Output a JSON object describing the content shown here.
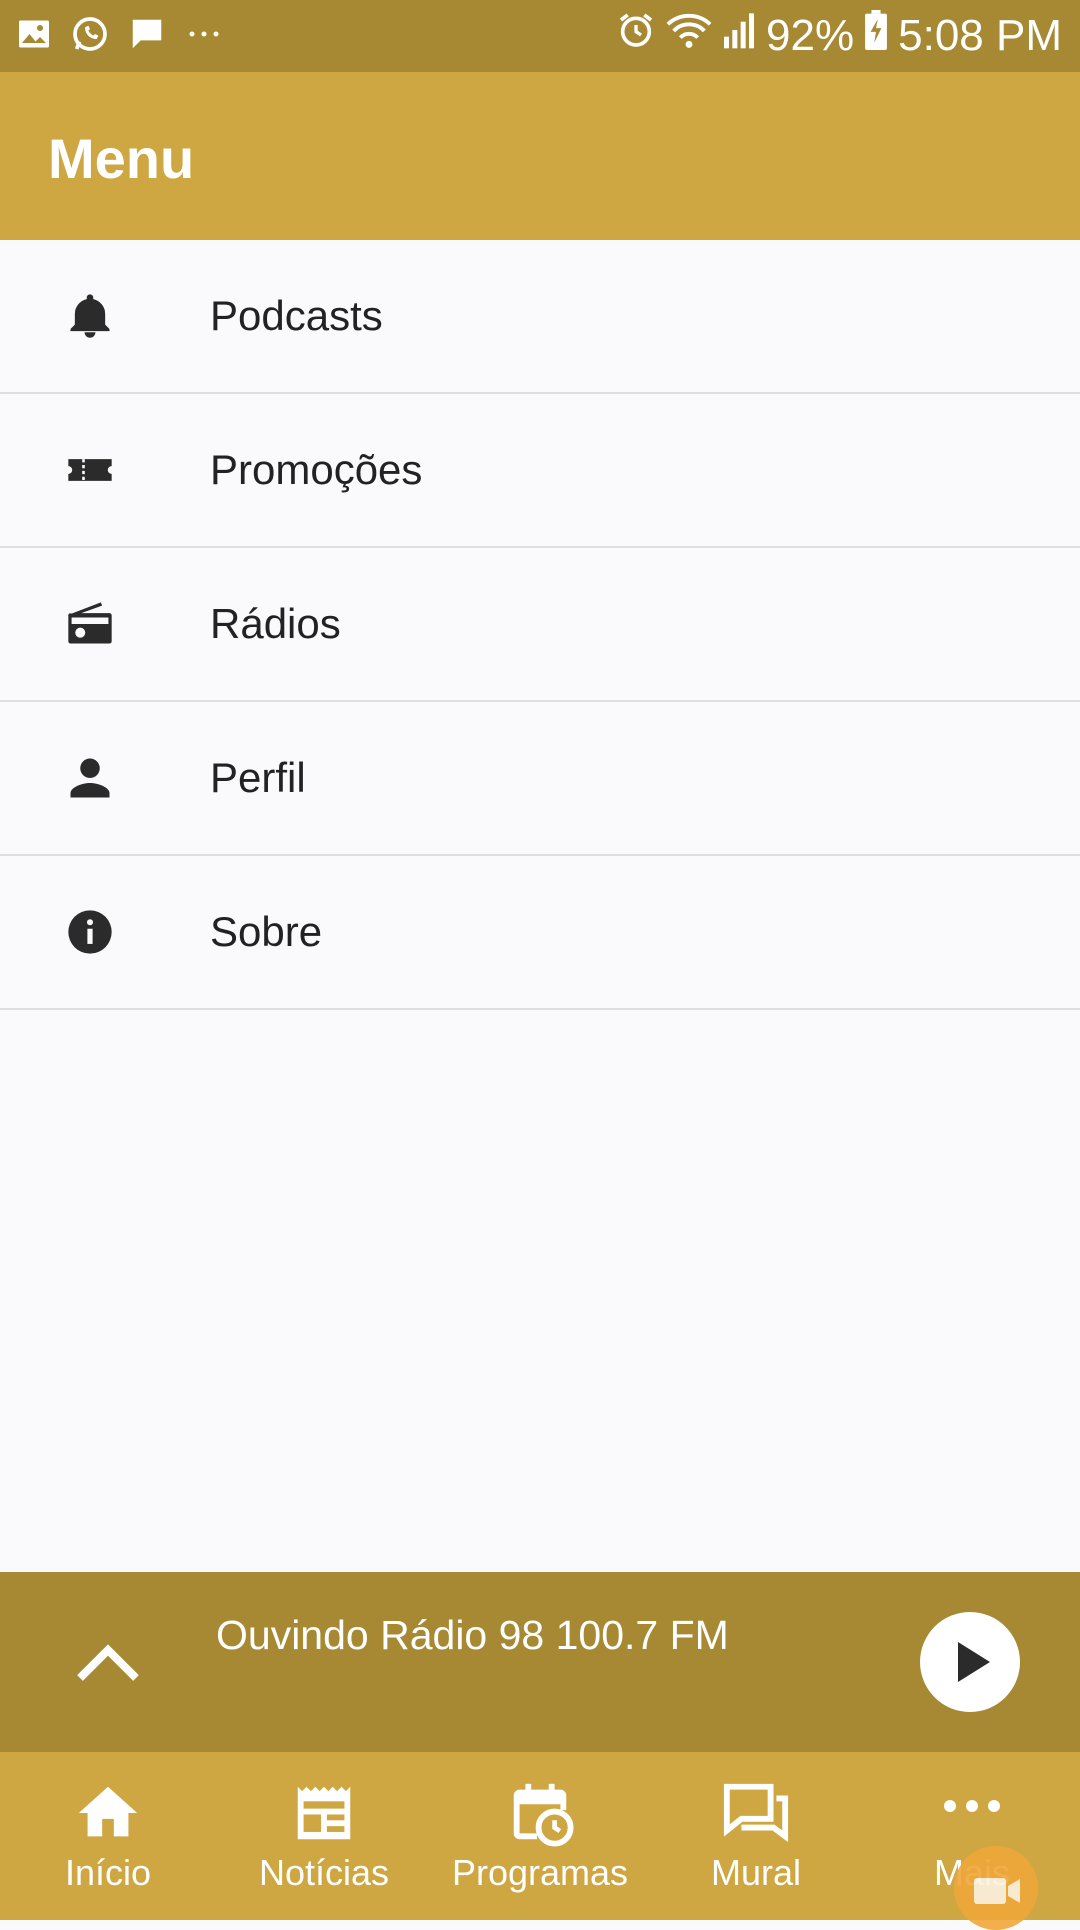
{
  "status_bar": {
    "battery": "92%",
    "time": "5:08 PM",
    "icons": [
      "gallery-icon",
      "whatsapp-icon",
      "message-icon",
      "more-dots-icon",
      "alarm-icon",
      "wifi-icon",
      "signal-icon",
      "battery-icon"
    ]
  },
  "app_bar": {
    "title": "Menu"
  },
  "menu": {
    "items": [
      {
        "label": "Podcasts",
        "icon": "bell-icon"
      },
      {
        "label": "Promoções",
        "icon": "ticket-icon"
      },
      {
        "label": "Rádios",
        "icon": "radio-icon"
      },
      {
        "label": "Perfil",
        "icon": "person-icon"
      },
      {
        "label": "Sobre",
        "icon": "info-icon"
      }
    ]
  },
  "player": {
    "now_playing": "Ouvindo Rádio 98 100.7 FM",
    "expand_icon": "chevron-up-icon",
    "play_icon": "play-icon"
  },
  "bottom_nav": {
    "tabs": [
      {
        "label": "Início",
        "icon": "home-icon"
      },
      {
        "label": "Notícias",
        "icon": "news-icon"
      },
      {
        "label": "Programas",
        "icon": "calendar-clock-icon"
      },
      {
        "label": "Mural",
        "icon": "chat-icon"
      },
      {
        "label": "Mais",
        "icon": "more-dots-icon"
      }
    ]
  },
  "colors": {
    "status_bar": "#a78934",
    "app_bar": "#cea742",
    "player_bar": "#a78934",
    "bottom_nav": "#cea742",
    "background": "#fafafc",
    "icon_dark": "#2b2b2b"
  }
}
